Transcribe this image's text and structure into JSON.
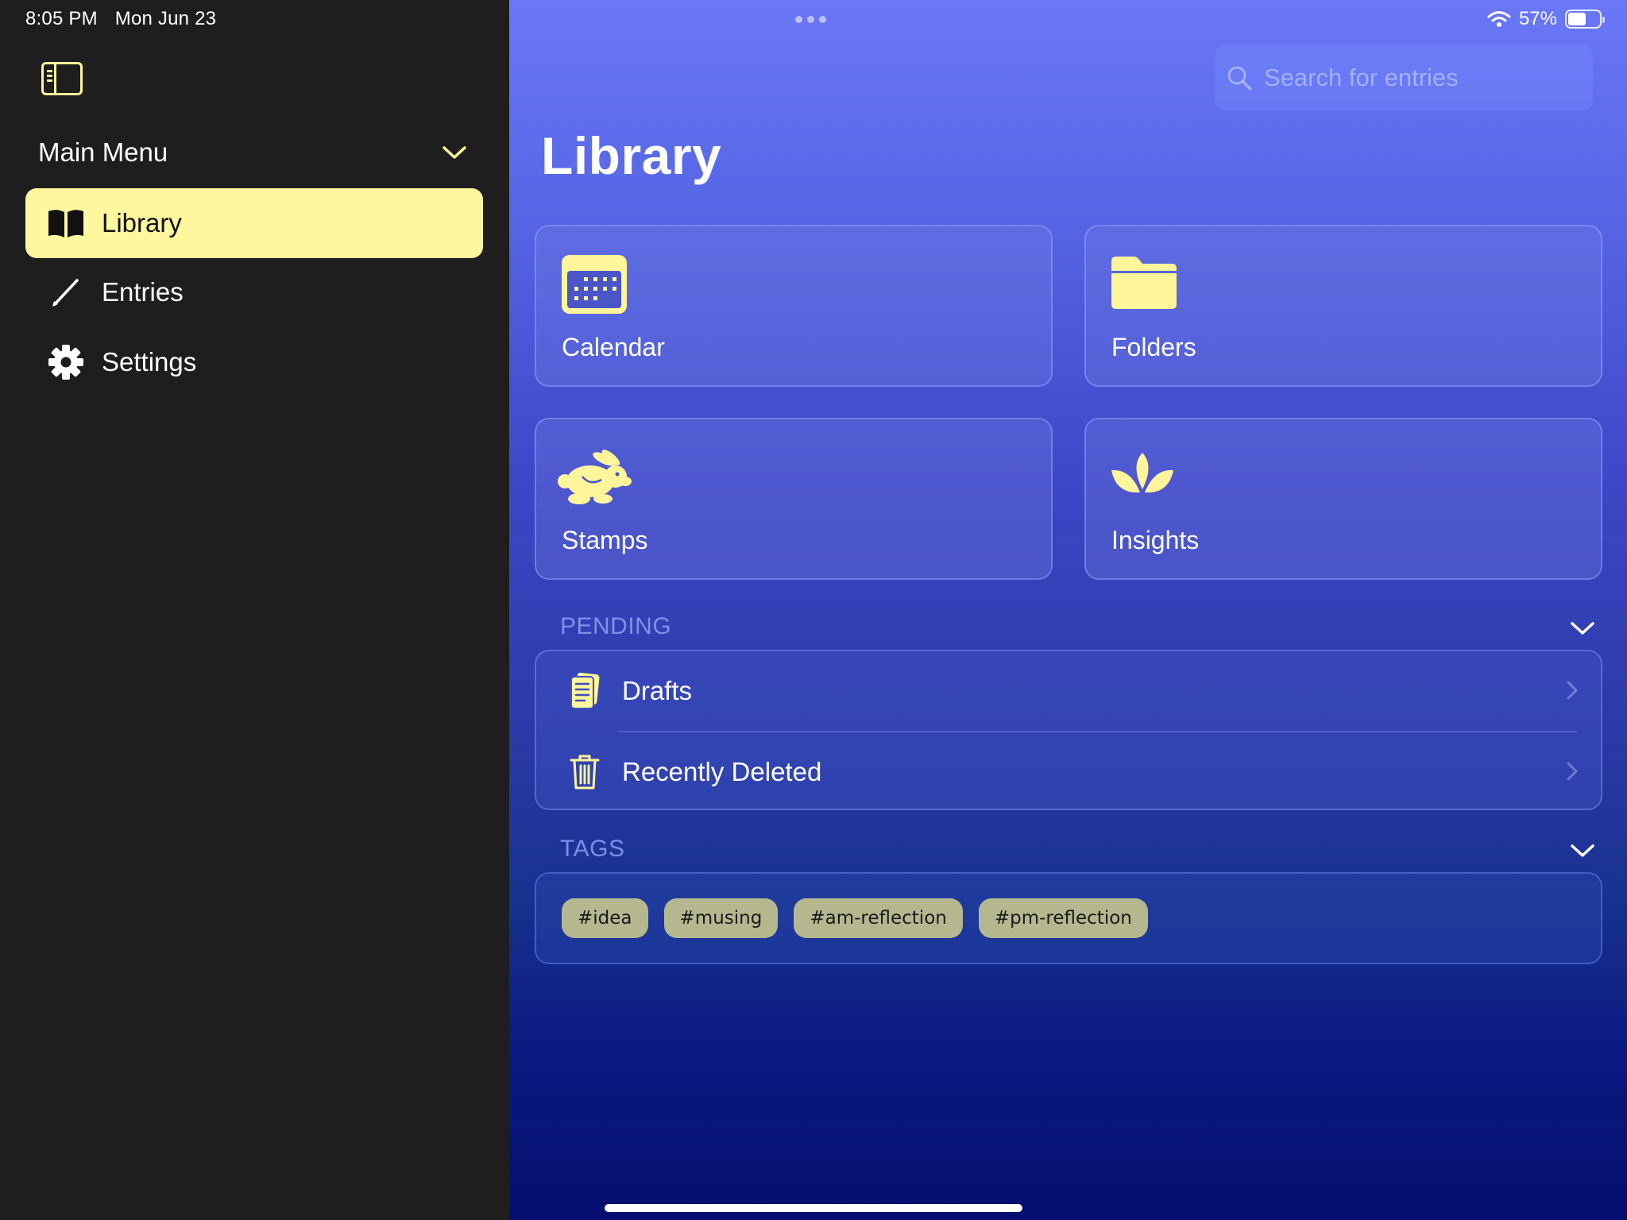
{
  "status_bar": {
    "time": "8:05 PM",
    "date": "Mon Jun 23",
    "battery": "57%",
    "battery_level": 0.57,
    "icons": [
      "wifi-icon",
      "battery-icon"
    ]
  },
  "sidebar": {
    "toggle_icon": "sidebar-toggle-icon",
    "menu_title": "Main Menu",
    "items": [
      {
        "label": "Library",
        "icon": "book-icon",
        "active": true
      },
      {
        "label": "Entries",
        "icon": "pencil-icon",
        "active": false
      },
      {
        "label": "Settings",
        "icon": "gear-icon",
        "active": false
      }
    ]
  },
  "main": {
    "search_placeholder": "Search for entries",
    "title": "Library",
    "tiles": [
      {
        "label": "Calendar",
        "icon": "calendar-icon"
      },
      {
        "label": "Folders",
        "icon": "folder-icon"
      },
      {
        "label": "Stamps",
        "icon": "rabbit-icon"
      },
      {
        "label": "Insights",
        "icon": "lotus-icon"
      }
    ],
    "pending": {
      "label": "PENDING",
      "rows": [
        {
          "label": "Drafts",
          "icon": "document-icon"
        },
        {
          "label": "Recently Deleted",
          "icon": "trash-icon"
        }
      ]
    },
    "tags": {
      "label": "TAGS",
      "items": [
        "#idea",
        "#musing",
        "#am-reflection",
        "#pm-reflection"
      ]
    }
  },
  "colors": {
    "accent_yellow": "#fff7a0",
    "sidebar_bg": "#1e1e1e",
    "tag_bg": "#b5b88f"
  }
}
